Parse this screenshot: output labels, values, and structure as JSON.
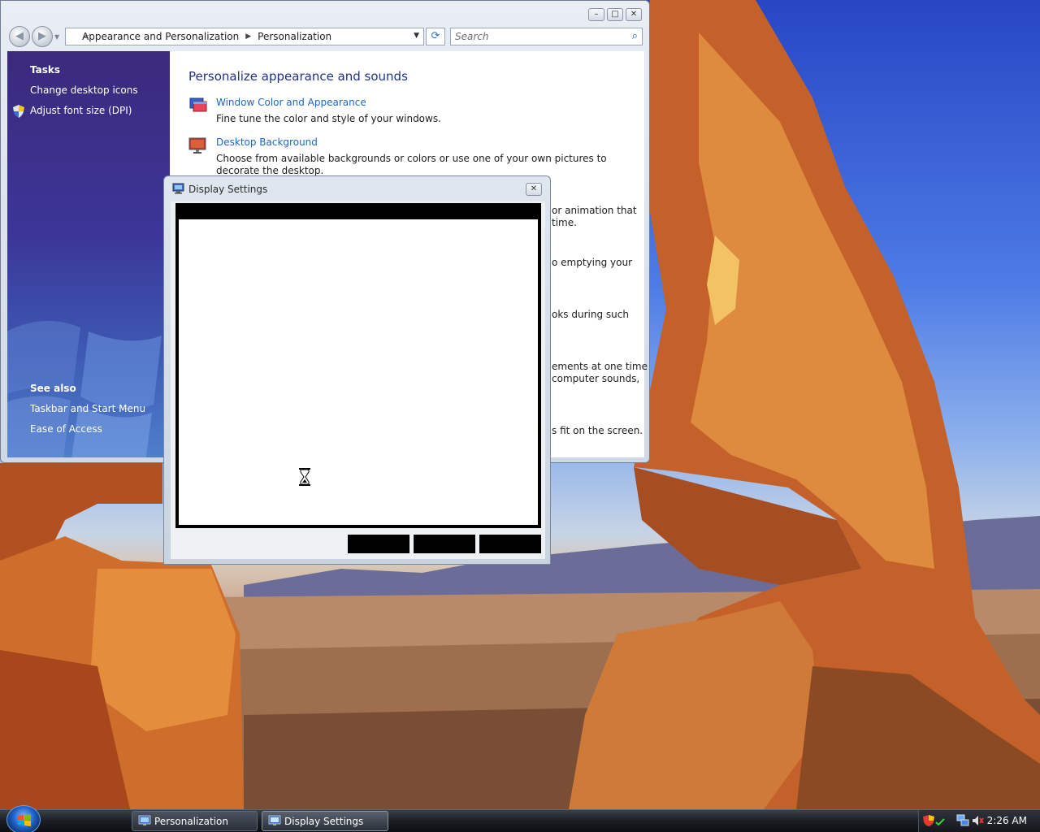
{
  "explorer": {
    "breadcrumb": [
      "Appearance and Personalization",
      "Personalization"
    ],
    "search_placeholder": "Search",
    "sidebar": {
      "tasks_header": "Tasks",
      "tasks": [
        "Change desktop icons",
        "Adjust font size (DPI)"
      ],
      "see_also_header": "See also",
      "see_also": [
        "Taskbar and Start Menu",
        "Ease of Access"
      ]
    },
    "content": {
      "title": "Personalize appearance and sounds",
      "items": [
        {
          "link": "Window Color and Appearance",
          "description": "Fine tune the color and style of your windows."
        },
        {
          "link": "Desktop Background",
          "description": "Choose from available backgrounds or colors or use one of your own pictures to decorate the desktop."
        }
      ],
      "obscured_fragments": [
        "or animation that\ntime.",
        "o emptying your",
        "oks during such",
        "ements at one time\ncomputer sounds,",
        "s fit on the screen."
      ]
    }
  },
  "dialog": {
    "title": "Display Settings",
    "icon": "display-settings-icon"
  },
  "taskbar": {
    "items": [
      {
        "label": "Personalization",
        "icon": "personalization-icon"
      },
      {
        "label": "Display Settings",
        "icon": "display-settings-icon"
      }
    ],
    "clock": "2:26 AM",
    "tray_icons": [
      "security-shield-icon",
      "network-icon",
      "volume-icon"
    ]
  },
  "colors": {
    "sidebar_top": "#3b2a7d",
    "link_blue": "#1e66c8",
    "title_blue": "#1e3287"
  }
}
